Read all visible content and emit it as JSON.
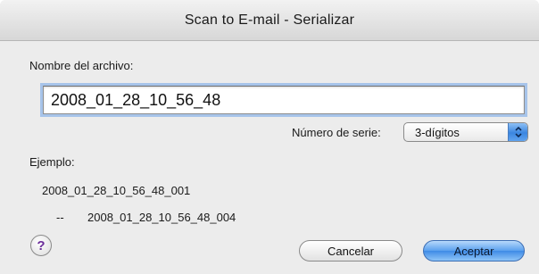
{
  "window": {
    "title": "Scan to E-mail - Serializar"
  },
  "form": {
    "filename_label": "Nombre del archivo:",
    "filename_value": "2008_01_28_10_56_48",
    "serial_label": "Número de serie:",
    "serial_value": "3-dígitos",
    "example_label": "Ejemplo:",
    "example_first": "2008_01_28_10_56_48_001",
    "example_separator": "--",
    "example_last": "2008_01_28_10_56_48_004"
  },
  "buttons": {
    "help": "?",
    "cancel": "Cancelar",
    "accept": "Aceptar"
  },
  "colors": {
    "window_bg": "#ececec",
    "accent_blue": "#3f8be6",
    "focus_ring": "#a7c4ea"
  },
  "icons": {
    "select_arrows": "up-down-chevron-icon",
    "help": "question-mark-icon"
  }
}
